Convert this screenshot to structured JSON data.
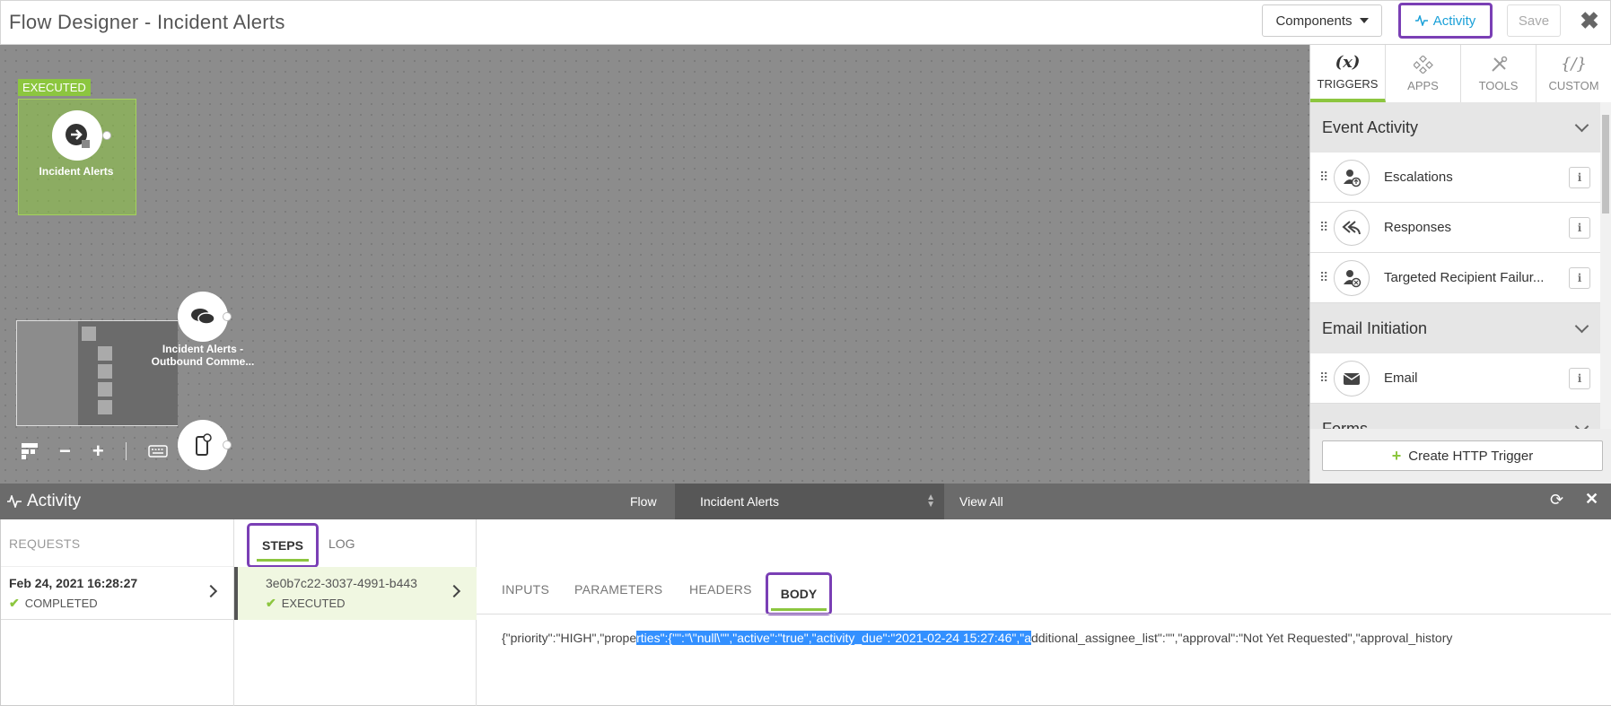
{
  "window": {
    "title": "Flow Designer - Incident Alerts"
  },
  "toolbar": {
    "components_label": "Components",
    "activity_label": "Activity",
    "save_label": "Save",
    "close_glyph": "✖"
  },
  "canvas": {
    "executed_tag": "EXECUTED",
    "nodes": [
      {
        "label": "Incident Alerts"
      },
      {
        "label": "Incident Alerts - Outbound Comme..."
      }
    ]
  },
  "right_panel": {
    "tabs": [
      {
        "label": "TRIGGERS",
        "icon": "(x)",
        "active": true
      },
      {
        "label": "APPS",
        "icon": "apps-icon"
      },
      {
        "label": "TOOLS",
        "icon": "tools-icon"
      },
      {
        "label": "CUSTOM",
        "icon": "{/}"
      }
    ],
    "sections": [
      {
        "title": "Event Activity",
        "items": [
          {
            "label": "Escalations",
            "icon": "user-escalation-icon"
          },
          {
            "label": "Responses",
            "icon": "reply-all-icon"
          },
          {
            "label": "Targeted Recipient Failur...",
            "icon": "user-fail-icon"
          }
        ]
      },
      {
        "title": "Email Initiation",
        "items": [
          {
            "label": "Email",
            "icon": "envelope-icon"
          }
        ]
      },
      {
        "title": "Forms"
      }
    ],
    "create_http_label": "Create HTTP Trigger"
  },
  "activity_bar": {
    "title": "Activity",
    "flow_label": "Flow",
    "flow_selected": "Incident Alerts",
    "view_all_label": "View All"
  },
  "requests": {
    "header": "REQUESTS",
    "items": [
      {
        "date": "Feb 24, 2021 16:28:27",
        "status": "COMPLETED"
      }
    ]
  },
  "steps": {
    "tabs": {
      "steps": "STEPS",
      "log": "LOG"
    },
    "items": [
      {
        "id": "3e0b7c22-3037-4991-b443",
        "status": "EXECUTED"
      }
    ]
  },
  "detail": {
    "tabs": {
      "inputs": "INPUTS",
      "parameters": "PARAMETERS",
      "headers": "HEADERS",
      "body": "BODY"
    },
    "body_before": "{\"priority\":\"HIGH\",\"prope",
    "body_highlight": "rties\":{\"\":\"\\\"null\\\"\",\"active\":\"true\",\"activity_due\":\"2021-02-24 15:27:46\",\"a",
    "body_after": "dditional_assignee_list\":\"\",\"approval\":\"Not Yet Requested\",\"approval_history"
  },
  "colors": {
    "accent_green": "#8cc63f",
    "highlight_purple": "#7a3fb5",
    "link_blue": "#1aa0d8"
  }
}
